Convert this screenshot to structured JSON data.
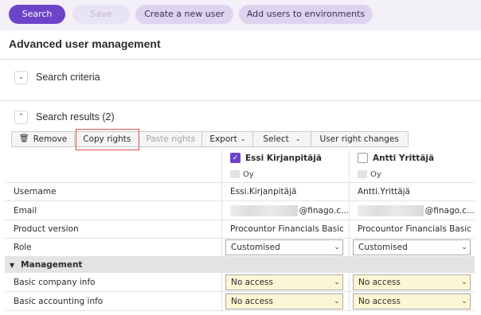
{
  "toolbar_top": {
    "search_label": "Search",
    "save_label": "Save",
    "create_label": "Create a new user",
    "add_env_label": "Add users to environments"
  },
  "page_title": "Advanced user management",
  "search_criteria": {
    "label": "Search criteria"
  },
  "search_results": {
    "label": "Search results (2)"
  },
  "actions": {
    "remove": "Remove",
    "copy_rights": "Copy rights",
    "paste_rights": "Paste rights",
    "export": "Export",
    "select": "Select",
    "user_right_changes": "User right changes"
  },
  "users": [
    {
      "name": "Essi Kirjanpitäjä",
      "checked": true,
      "company": "Oy",
      "username": "Essi.Kirjanpitäjä",
      "email_suffix": "@finago.c...",
      "product_version": "Procountor Financials Basic",
      "role": "Customised",
      "basic_company_info": "No access",
      "basic_accounting_info": "No access"
    },
    {
      "name": "Antti Yrittäjä",
      "checked": false,
      "company": "Oy",
      "username": "Antti.Yrittäjä",
      "email_suffix": "@finago.c...",
      "product_version": "Procountor Financials Basic",
      "role": "Customised",
      "basic_company_info": "No access",
      "basic_accounting_info": "No access"
    }
  ],
  "row_labels": {
    "username": "Username",
    "email": "Email",
    "product_version": "Product version",
    "role": "Role",
    "group_management": "Management",
    "basic_company_info": "Basic company info",
    "basic_accounting_info": "Basic accounting info"
  },
  "colors": {
    "accent": "#6c43c9",
    "top_bar": "#f3f0f8",
    "secondary_button": "#ddd4ef",
    "no_access_fill": "#fdf6d5",
    "highlight": "#d9534f"
  }
}
